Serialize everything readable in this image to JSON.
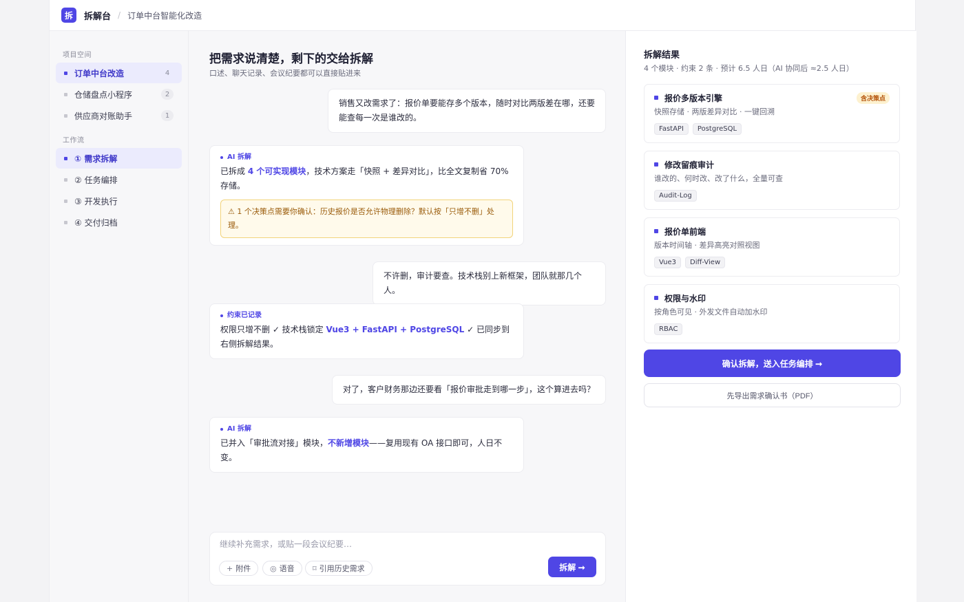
{
  "topbar": {
    "logo_char": "拆",
    "app_name": "拆解台",
    "separator": "/",
    "breadcrumb": "订单中台智能化改造"
  },
  "sidebar": {
    "projects_label": "项目空间",
    "projects": [
      {
        "label": "订单中台改造",
        "count": "4",
        "active": true
      },
      {
        "label": "仓储盘点小程序",
        "count": "2",
        "active": false
      },
      {
        "label": "供应商对账助手",
        "count": "1",
        "active": false
      }
    ],
    "workflow_label": "工作流",
    "workflow": [
      {
        "label": "① 需求拆解",
        "active": true
      },
      {
        "label": "② 任务编排",
        "active": false
      },
      {
        "label": "③ 开发执行",
        "active": false
      },
      {
        "label": "④ 交付归档",
        "active": false
      }
    ]
  },
  "main": {
    "title": "把需求说清楚，剩下的交给拆解",
    "subtitle": "口述、聊天记录、会议纪要都可以直接贴进来",
    "messages": {
      "m1": {
        "text": "销售又改需求了：报价单要能存多个版本，随时对比两版差在哪，还要能查每一次是谁改的。"
      },
      "m2": {
        "tag": "AI 拆解",
        "pre": "已拆成 ",
        "highlight": "4 个可实现模块",
        "post": "，技术方案走「快照 + 差异对比」，比全文复制省 70% 存储。",
        "warning": "⚠ 1 个决策点需要你确认：历史报价是否允许物理删除？默认按「只增不删」处理。"
      },
      "m3": {
        "text": "不许删，审计要查。技术栈别上新框架，团队就那几个人。"
      },
      "m4": {
        "tag": "约束已记录",
        "pre": "权限只增不删 ✓  技术栈锁定 ",
        "highlight": "Vue3 + FastAPI + PostgreSQL",
        "post": " ✓  已同步到右侧拆解结果。"
      },
      "m5": {
        "text": "对了，客户财务那边还要看「报价审批走到哪一步」，这个算进去吗？"
      },
      "m6": {
        "tag": "AI 拆解",
        "pre": "已并入「审批流对接」模块，",
        "highlight": "不新增模块",
        "post": "——复用现有 OA 接口即可，人日不变。"
      }
    },
    "composer": {
      "placeholder": "继续补充需求，或贴一段会议纪要…",
      "attach_icon": "+",
      "attach_label": "附件",
      "voice_icon": "◎",
      "voice_label": "语音",
      "history_icon": "⌑",
      "history_label": "引用历史需求",
      "send_label": "拆解 ➞"
    }
  },
  "panel": {
    "title": "拆解结果",
    "subtitle": "4 个模块 · 约束 2 条 · 预计 6.5 人日（AI 协同后 ≈2.5 人日）",
    "cards": [
      {
        "title": "报价多版本引擎",
        "badge": "含决策点",
        "desc": "快照存储 · 两版差异对比 · 一键回溯",
        "tags": [
          "FastAPI",
          "PostgreSQL"
        ]
      },
      {
        "title": "修改留痕审计",
        "badge": "",
        "desc": "谁改的、何时改、改了什么，全量可查",
        "tags": [
          "Audit-Log"
        ]
      },
      {
        "title": "报价单前端",
        "badge": "",
        "desc": "版本时间轴 · 差异高亮对照视图",
        "tags": [
          "Vue3",
          "Diff-View"
        ]
      },
      {
        "title": "权限与水印",
        "badge": "",
        "desc": "按角色可见 · 外发文件自动加水印",
        "tags": [
          "RBAC"
        ]
      }
    ],
    "confirm_label": "确认拆解，送入任务编排 ➞",
    "export_label": "先导出需求确认书（PDF）"
  },
  "colors": {
    "accent": "#4f46e5",
    "warning_bg": "#fffaeb",
    "warning_text": "#9a5b0a",
    "badge_bg": "#fdf1cf"
  }
}
